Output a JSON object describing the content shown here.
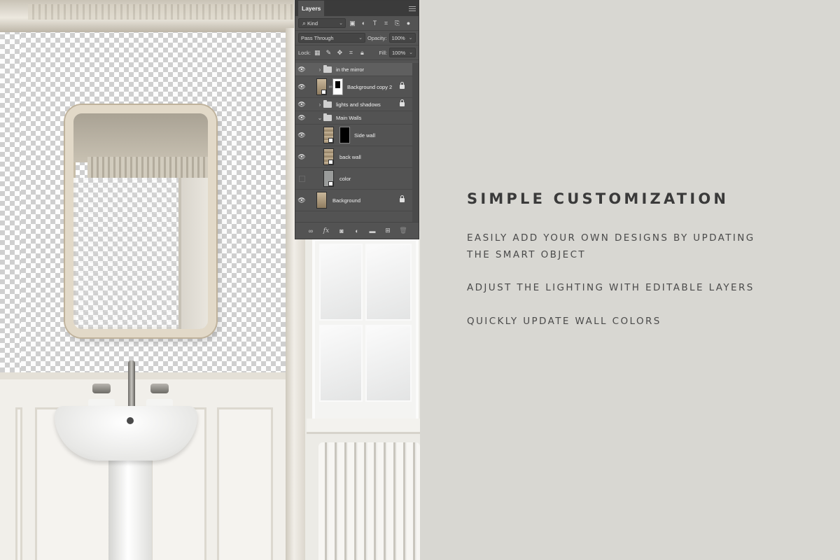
{
  "layers_panel": {
    "tab_label": "Layers",
    "filter_kind": "Kind",
    "blend_mode": "Pass Through",
    "opacity_label": "Opacity:",
    "opacity_value": "100%",
    "lock_label": "Lock:",
    "fill_label": "Fill:",
    "fill_value": "100%",
    "layers": [
      {
        "name": "in the mirror",
        "type": "group",
        "visible": true,
        "expanded": false,
        "selected": true,
        "locked": false
      },
      {
        "name": "Background copy 2",
        "type": "smart-object-with-mask",
        "visible": true,
        "locked": true
      },
      {
        "name": "lights and shadows",
        "type": "group",
        "visible": true,
        "expanded": false,
        "locked": true
      },
      {
        "name": "Main Walls",
        "type": "group",
        "visible": true,
        "expanded": true,
        "locked": false
      },
      {
        "name": "Side wall",
        "type": "smart-object-with-mask",
        "visible": true,
        "locked": false
      },
      {
        "name": "back wall",
        "type": "smart-object",
        "visible": true,
        "locked": false
      },
      {
        "name": "color",
        "type": "smart-object",
        "visible": false,
        "locked": false
      },
      {
        "name": "Background",
        "type": "image",
        "visible": true,
        "locked": true
      }
    ],
    "footer_icons": [
      "link-icon",
      "fx-icon",
      "mask-icon",
      "adjustment-icon",
      "folder-icon",
      "new-layer-icon",
      "trash-icon"
    ]
  },
  "content": {
    "headline": "SIMPLE CUSTOMIZATION",
    "features": [
      {
        "line1": "Easily add your own designs by updating",
        "line2": "the smart object"
      },
      {
        "line1": "Adjust the lighting with editable layers"
      },
      {
        "line1": "Quickly update wall colors"
      }
    ]
  },
  "colors": {
    "background": "#d8d7d2",
    "panel": "#535353",
    "heading_text": "#3a3a3a"
  }
}
